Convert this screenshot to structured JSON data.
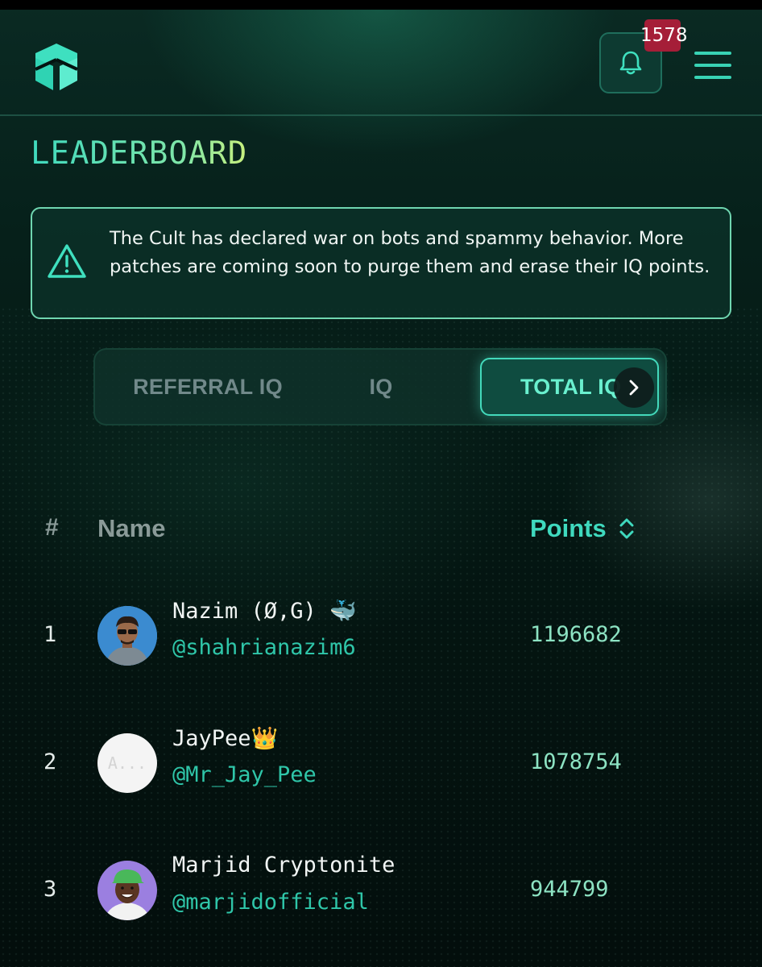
{
  "header": {
    "notification_count": "1578"
  },
  "page_title": "LEADERBOARD",
  "notice": {
    "text": "The Cult has declared war on bots and spammy behavior. More patches are coming soon to purge them and erase their IQ points."
  },
  "tabs": [
    {
      "label": "REFERRAL IQ",
      "active": false
    },
    {
      "label": "IQ",
      "active": false
    },
    {
      "label": "TOTAL IQ",
      "active": true
    }
  ],
  "table": {
    "columns": {
      "rank": "#",
      "name": "Name",
      "points": "Points"
    },
    "rows": [
      {
        "rank": "1",
        "name": "Nazim (Ø,G) 🐳",
        "handle": "@shahrianazim6",
        "points": "1196682"
      },
      {
        "rank": "2",
        "name": "JayPee👑",
        "handle": "@Mr_Jay_Pee",
        "points": "1078754",
        "avatar_alt": "A..."
      },
      {
        "rank": "3",
        "name": "Marjid Cryptonite",
        "handle": "@marjidofficial",
        "points": "944799"
      }
    ]
  },
  "colors": {
    "accent": "#3fd9be",
    "badge": "#a51e38",
    "background": "#041411"
  },
  "icons": [
    "logo-icon",
    "bell-icon",
    "menu-icon",
    "warning-icon",
    "chevron-right-icon",
    "sort-icon"
  ]
}
